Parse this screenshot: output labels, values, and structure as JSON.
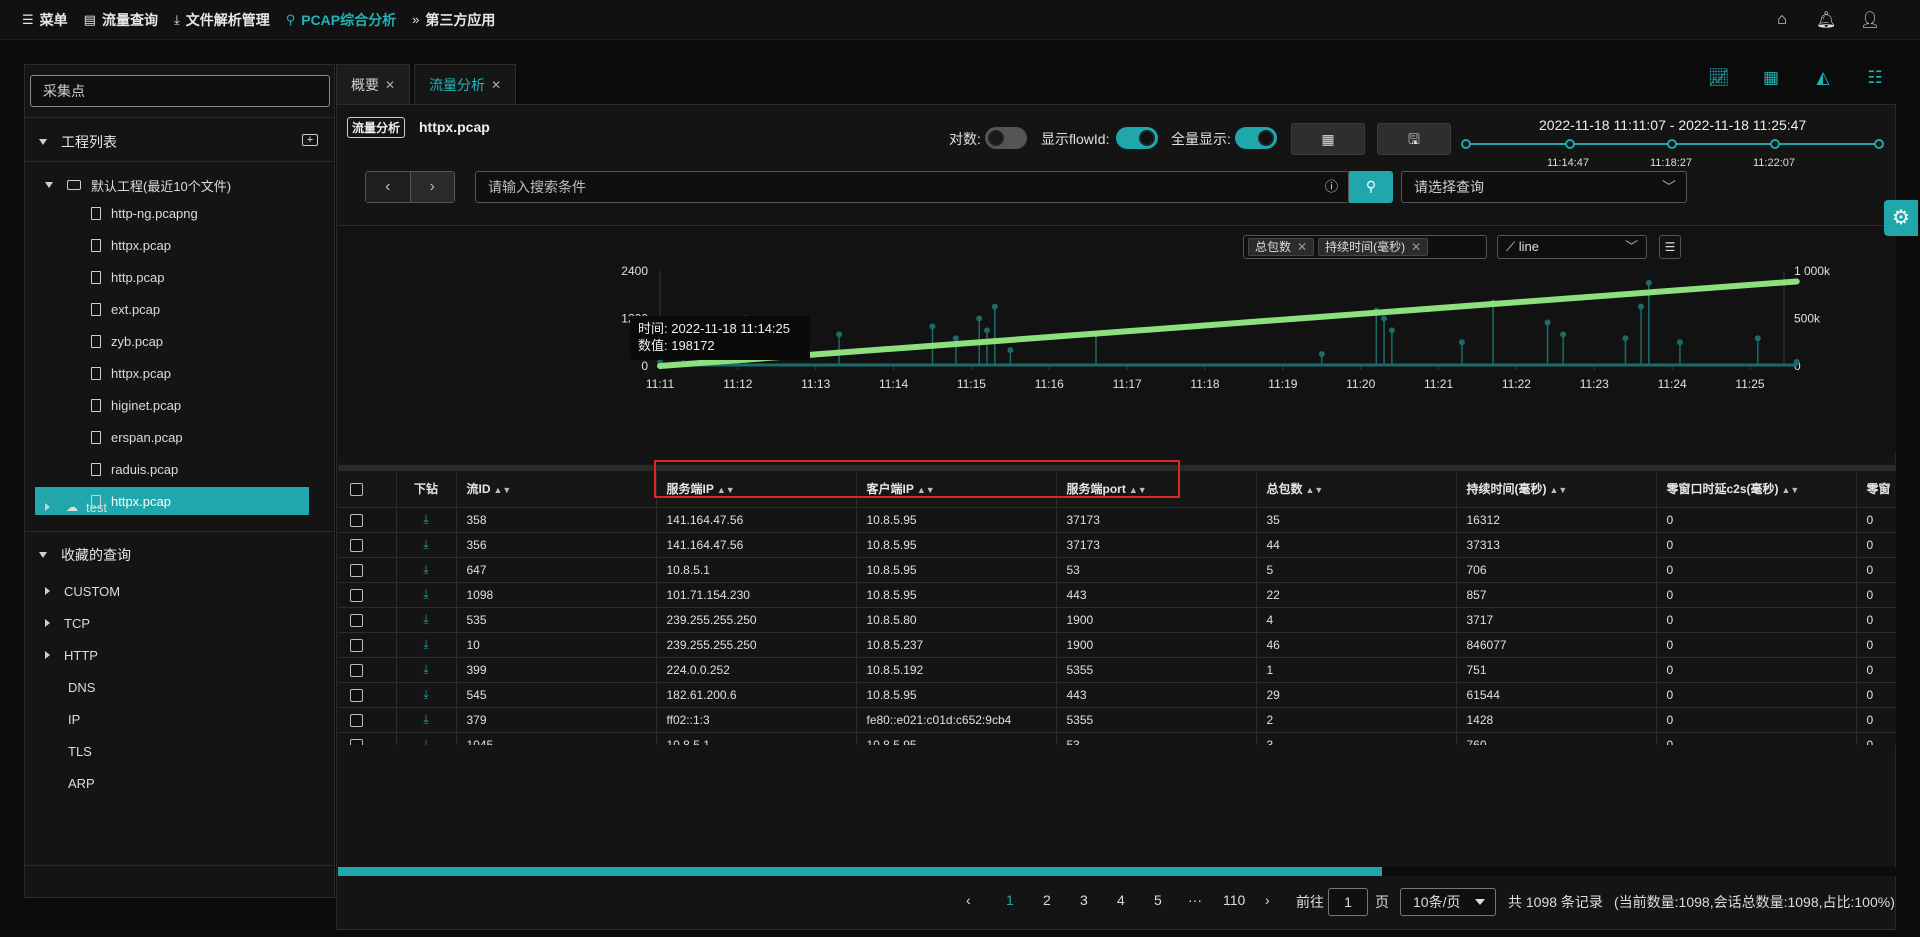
{
  "topnav": {
    "items": [
      {
        "icon": "menu-icon",
        "label": "菜单"
      },
      {
        "icon": "doc-icon",
        "label": "流量查询"
      },
      {
        "icon": "download-icon",
        "label": "文件解析管理"
      },
      {
        "icon": "search-icon",
        "label": "PCAP综合分析"
      },
      {
        "icon": "double-chevron-icon",
        "label": "第三方应用"
      }
    ],
    "active_index": 3
  },
  "sidebar": {
    "collector_placeholder": "采集点",
    "project_list_title": "工程列表",
    "default_project": "默认工程(最近10个文件)",
    "files": [
      "http-ng.pcapng",
      "httpx.pcap",
      "http.pcap",
      "ext.pcap",
      "zyb.pcap",
      "httpx.pcap",
      "higinet.pcap",
      "erspan.pcap",
      "raduis.pcap",
      "httpx.pcap"
    ],
    "selected_file_index": 9,
    "other_project": "test",
    "favorites_title": "收藏的查询",
    "favorites": [
      {
        "label": "CUSTOM",
        "expandable": true
      },
      {
        "label": "TCP",
        "expandable": true
      },
      {
        "label": "HTTP",
        "expandable": true
      },
      {
        "label": "DNS",
        "expandable": false
      },
      {
        "label": "IP",
        "expandable": false
      },
      {
        "label": "TLS",
        "expandable": false
      },
      {
        "label": "ARP",
        "expandable": false
      }
    ]
  },
  "tabs": [
    {
      "label": "概要",
      "active": false
    },
    {
      "label": "流量分析",
      "active": true
    }
  ],
  "toolbar": {
    "badge": "流量分析",
    "filename": "httpx.pcap",
    "log_label": "对数:",
    "log_on": false,
    "flowid_label": "显示flowId:",
    "flowid_on": true,
    "fullshow_label": "全量显示:",
    "fullshow_on": true,
    "date_range": "2022-11-18 11:11:07 - 2022-11-18 11:25:47",
    "slider_ticks": [
      "11:14:47",
      "11:18:27",
      "11:22:07"
    ],
    "search_placeholder": "请输入搜索条件",
    "select_placeholder": "请选择查询"
  },
  "chart_controls": {
    "tags": [
      "总包数",
      "持续时间(毫秒)"
    ],
    "chart_type": "line"
  },
  "chart_data": {
    "type": "line",
    "x_ticks": [
      "11:11",
      "11:12",
      "11:13",
      "11:14",
      "11:15",
      "11:16",
      "11:17",
      "11:18",
      "11:19",
      "11:20",
      "11:21",
      "11:22",
      "11:23",
      "11:24",
      "11:25"
    ],
    "y_left_ticks": [
      "0",
      "1200",
      "2400"
    ],
    "y_right_ticks": [
      "0",
      "500k",
      "1 000k"
    ],
    "ylim_left": [
      0,
      2400
    ],
    "ylim_right": [
      0,
      1000000
    ],
    "series": [
      {
        "name": "总包数",
        "axis": "left",
        "color": "#1a6b6a",
        "x": [
          0.0,
          0.3,
          0.6,
          1.0,
          1.1,
          2.3,
          3.5,
          3.8,
          4.1,
          4.2,
          4.3,
          4.5,
          5.6,
          8.5,
          9.2,
          9.3,
          9.4,
          10.3,
          10.7,
          11.4,
          11.6,
          12.4,
          12.6,
          12.7,
          13.1,
          14.1,
          14.6
        ],
        "y": [
          100,
          600,
          400,
          250,
          1200,
          800,
          1000,
          700,
          1200,
          900,
          1500,
          400,
          800,
          300,
          1400,
          1200,
          900,
          600,
          1600,
          1100,
          800,
          700,
          1500,
          2100,
          600,
          700,
          100
        ]
      },
      {
        "name": "持续时间(毫秒)",
        "axis": "right",
        "color": "#8ee07e",
        "x": [
          0.0,
          14.6
        ],
        "y": [
          0,
          890000
        ]
      }
    ]
  },
  "tooltip": {
    "time_line": "时间:  2022-11-18 11:14:25",
    "value_line": "数值:  198172"
  },
  "table": {
    "columns": [
      "下钻",
      "流ID",
      "服务端IP",
      "客户端IP",
      "服务端port",
      "总包数",
      "持续时间(毫秒)",
      "零窗口时延c2s(毫秒)",
      "零窗"
    ],
    "rows": [
      [
        "358",
        "141.164.47.56",
        "10.8.5.95",
        "37173",
        "35",
        "16312",
        "0",
        "0"
      ],
      [
        "356",
        "141.164.47.56",
        "10.8.5.95",
        "37173",
        "44",
        "37313",
        "0",
        "0"
      ],
      [
        "647",
        "10.8.5.1",
        "10.8.5.95",
        "53",
        "5",
        "706",
        "0",
        "0"
      ],
      [
        "1098",
        "101.71.154.230",
        "10.8.5.95",
        "443",
        "22",
        "857",
        "0",
        "0"
      ],
      [
        "535",
        "239.255.255.250",
        "10.8.5.80",
        "1900",
        "4",
        "3717",
        "0",
        "0"
      ],
      [
        "10",
        "239.255.255.250",
        "10.8.5.237",
        "1900",
        "46",
        "846077",
        "0",
        "0"
      ],
      [
        "399",
        "224.0.0.252",
        "10.8.5.192",
        "5355",
        "1",
        "751",
        "0",
        "0"
      ],
      [
        "545",
        "182.61.200.6",
        "10.8.5.95",
        "443",
        "29",
        "61544",
        "0",
        "0"
      ],
      [
        "379",
        "ff02::1:3",
        "fe80::e021:c01d:c652:9cb4",
        "5355",
        "2",
        "1428",
        "0",
        "0"
      ],
      [
        "1045",
        "10.8.5.1",
        "10.8.5.95",
        "53",
        "3",
        "760",
        "0",
        "0"
      ]
    ]
  },
  "pagination": {
    "pages": [
      "1",
      "2",
      "3",
      "4",
      "5",
      "···",
      "110"
    ],
    "current": "1",
    "goto_label": "前往",
    "goto_value": "1",
    "page_unit": "页",
    "page_size": "10条/页",
    "total": "共 1098 条记录",
    "summary": "(当前数量:1098,会话总数量:1098,占比:100%)"
  }
}
